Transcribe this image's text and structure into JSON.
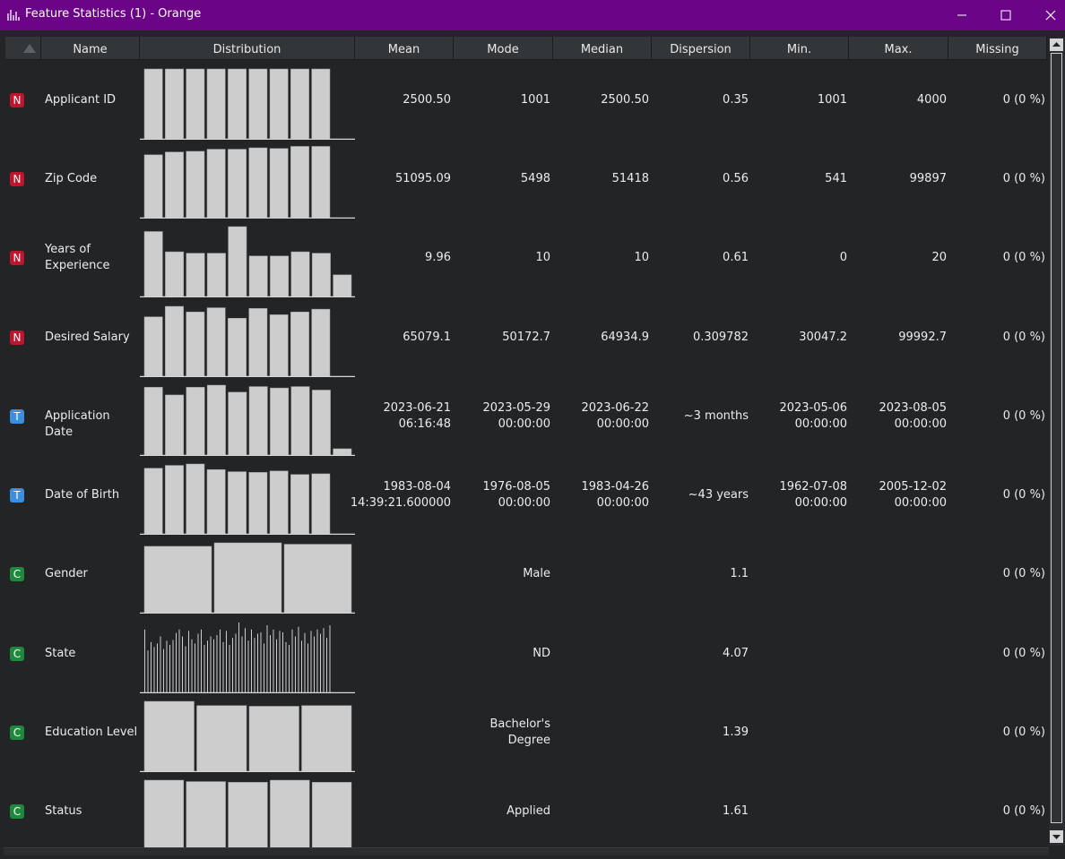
{
  "window": {
    "title": "Feature Statistics (1) - Orange"
  },
  "colors": {
    "titlebar": "#6b0487",
    "background": "#222426",
    "numeric_badge": "#c1152d",
    "time_badge": "#3b8fe1",
    "categorical_badge": "#1c8a3a",
    "bar_fill": "#cdcdcd"
  },
  "columns": [
    "Name",
    "Distribution",
    "Mean",
    "Mode",
    "Median",
    "Dispersion",
    "Min.",
    "Max.",
    "Missing"
  ],
  "rows": [
    {
      "type": "N",
      "name": "Applicant ID",
      "mean": "2500.50",
      "mode": "1001",
      "median": "2500.50",
      "dispersion": "0.35",
      "min": "1001",
      "max": "4000",
      "missing": "0 (0 %)",
      "hist": [
        1,
        1,
        1,
        1,
        1,
        1,
        1,
        1,
        1
      ]
    },
    {
      "type": "N",
      "name": "Zip Code",
      "mean": "51095.09",
      "mode": "5498",
      "median": "51418",
      "dispersion": "0.56",
      "min": "541",
      "max": "99897",
      "missing": "0 (0 %)",
      "hist": [
        0.9,
        0.94,
        0.95,
        0.98,
        0.98,
        1.0,
        0.99,
        1.02,
        1.02
      ]
    },
    {
      "type": "N",
      "name": "Years of Experience",
      "mean": "9.96",
      "mode": "10",
      "median": "10",
      "dispersion": "0.61",
      "min": "0",
      "max": "20",
      "missing": "0 (0 %)",
      "hist": [
        0.93,
        0.64,
        0.62,
        0.62,
        1.0,
        0.58,
        0.58,
        0.64,
        0.62,
        0.31
      ]
    },
    {
      "type": "N",
      "name": "Desired Salary",
      "mean": "65079.1",
      "mode": "50172.7",
      "median": "64934.9",
      "dispersion": "0.309782",
      "min": "30047.2",
      "max": "99992.7",
      "missing": "0 (0 %)",
      "hist": [
        0.85,
        1.0,
        0.92,
        0.98,
        0.83,
        0.97,
        0.88,
        0.92,
        0.96
      ]
    },
    {
      "type": "T",
      "name": "Application Date",
      "mean": "2023-06-21\n06:16:48",
      "mode": "2023-05-29\n00:00:00",
      "median": "2023-06-22\n00:00:00",
      "dispersion": "~3 months",
      "min": "2023-05-06\n00:00:00",
      "max": "2023-08-05\n00:00:00",
      "missing": "0 (0 %)",
      "hist": [
        0.97,
        0.86,
        0.97,
        1.0,
        0.9,
        0.98,
        0.96,
        0.98,
        0.93,
        0.09
      ]
    },
    {
      "type": "T",
      "name": "Date of Birth",
      "mean": "1983-08-04\n14:39:21.600000",
      "mode": "1976-08-05\n00:00:00",
      "median": "1983-04-26\n00:00:00",
      "dispersion": "~43 years",
      "min": "1962-07-08\n00:00:00",
      "max": "2005-12-02\n00:00:00",
      "missing": "0 (0 %)",
      "hist": [
        0.94,
        0.98,
        1.0,
        0.92,
        0.89,
        0.88,
        0.9,
        0.85,
        0.86
      ]
    },
    {
      "type": "C",
      "name": "Gender",
      "mean": "",
      "mode": "Male",
      "median": "",
      "dispersion": "1.1",
      "min": "",
      "max": "",
      "missing": "0 (0 %)",
      "hist": [
        0.95,
        1.0,
        0.98
      ]
    },
    {
      "type": "C",
      "name": "State",
      "mean": "",
      "mode": "ND",
      "median": "",
      "dispersion": "4.07",
      "min": "",
      "max": "",
      "missing": "0 (0 %)",
      "hist": [
        0.9,
        0.6,
        0.72,
        0.65,
        0.7,
        0.8,
        0.62,
        0.74,
        0.68,
        0.75,
        0.85,
        0.9,
        0.8,
        0.66,
        0.88,
        0.76,
        0.7,
        0.84,
        0.9,
        0.68,
        0.74,
        0.8,
        0.76,
        0.82,
        0.9,
        0.72,
        0.88,
        0.68,
        0.78,
        0.84,
        1.0,
        0.8,
        0.92,
        0.74,
        0.9,
        0.78,
        0.84,
        0.86,
        0.7,
        0.96,
        0.82,
        0.9,
        0.76,
        0.88,
        0.86,
        0.72,
        0.68,
        0.9,
        0.8,
        0.94,
        0.74,
        0.85,
        0.7,
        0.88,
        0.8,
        0.9,
        0.84,
        0.92,
        0.78,
        0.96
      ]
    },
    {
      "type": "C",
      "name": "Education Level",
      "mean": "",
      "mode": "Bachelor's\nDegree",
      "median": "",
      "dispersion": "1.39",
      "min": "",
      "max": "",
      "missing": "0 (0 %)",
      "hist": [
        1.0,
        0.94,
        0.93,
        0.94
      ]
    },
    {
      "type": "C",
      "name": "Status",
      "mean": "",
      "mode": "Applied",
      "median": "",
      "dispersion": "1.61",
      "min": "",
      "max": "",
      "missing": "0 (0 %)",
      "hist": [
        1.0,
        0.98,
        0.97,
        1.0,
        0.97
      ]
    }
  ]
}
